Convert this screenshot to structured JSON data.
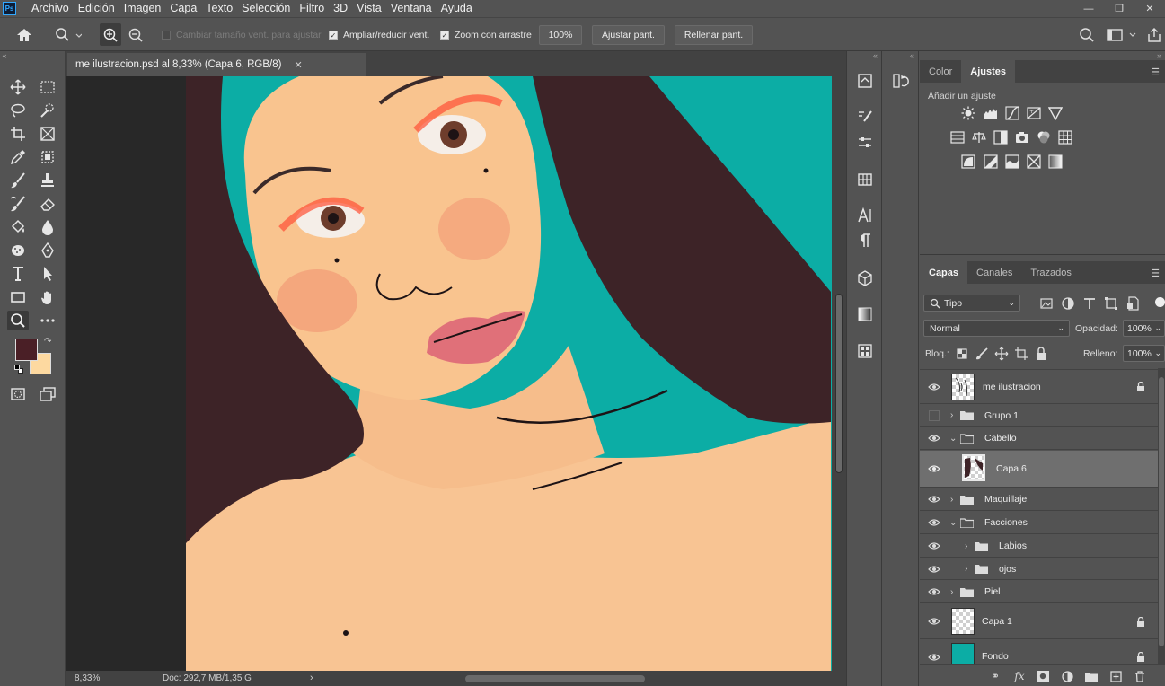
{
  "app": {
    "logo": "Ps"
  },
  "menu": [
    "Archivo",
    "Edición",
    "Imagen",
    "Capa",
    "Texto",
    "Selección",
    "Filtro",
    "3D",
    "Vista",
    "Ventana",
    "Ayuda"
  ],
  "options": {
    "resize_windows": "Cambiar tamaño vent. para ajustar",
    "zoom_all": "Ampliar/reducir vent.",
    "scrubby": "Zoom con arrastre",
    "percent": "100%",
    "fit": "Ajustar pant.",
    "fill": "Rellenar pant."
  },
  "document": {
    "tab_title": "me ilustracion.psd al 8,33% (Capa 6, RGB/8)"
  },
  "status": {
    "zoom": "8,33%",
    "doc": "Doc: 292,7 MB/1,35 G"
  },
  "colors": {
    "foreground": "#4a1f26",
    "background": "#fdd9a0",
    "canvas_bg": "#0cada5",
    "skin": "#f8c493",
    "hair": "#3d2327"
  },
  "adjust_panel": {
    "tabs": [
      "Color",
      "Ajustes"
    ],
    "active": "Ajustes",
    "title": "Añadir un ajuste"
  },
  "layers_panel": {
    "tabs": [
      "Capas",
      "Canales",
      "Trazados"
    ],
    "filter": "Tipo",
    "blend_mode": "Normal",
    "opacity_label": "Opacidad:",
    "opacity": "100%",
    "lock_label": "Bloq.:",
    "fill_label": "Relleno:",
    "fill": "100%",
    "layers": [
      {
        "name": "me ilustracion",
        "kind": "layer"
      },
      {
        "name": "Grupo 1",
        "kind": "group"
      },
      {
        "name": "Cabello",
        "kind": "group-open"
      },
      {
        "name": "Capa 6",
        "kind": "layer"
      },
      {
        "name": "Maquillaje",
        "kind": "group"
      },
      {
        "name": "Facciones",
        "kind": "group-open"
      },
      {
        "name": "Labios",
        "kind": "group"
      },
      {
        "name": "ojos",
        "kind": "group"
      },
      {
        "name": "Piel",
        "kind": "group"
      },
      {
        "name": "Capa 1",
        "kind": "layer"
      },
      {
        "name": "Fondo",
        "kind": "layer"
      }
    ]
  }
}
